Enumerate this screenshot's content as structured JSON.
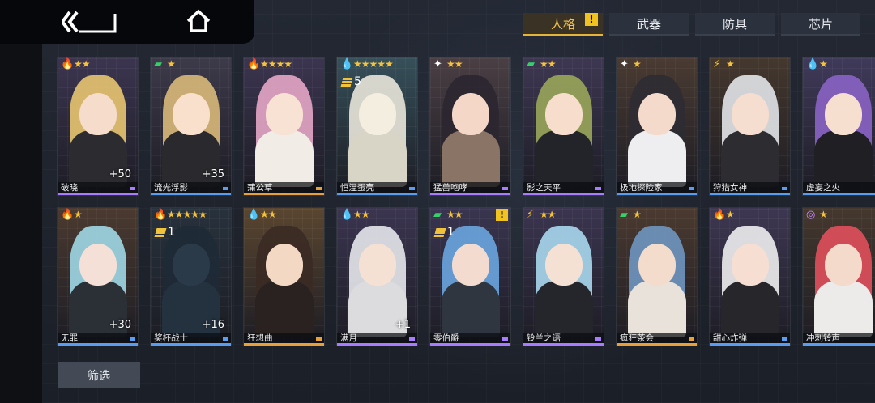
{
  "nav": {
    "back_icon": "back-chevron-icon",
    "home_icon": "home-icon"
  },
  "tabs": [
    {
      "label": "人格",
      "active": true,
      "alert": "!"
    },
    {
      "label": "武器",
      "active": false
    },
    {
      "label": "防具",
      "active": false
    },
    {
      "label": "芯片",
      "active": false
    }
  ],
  "filter": {
    "label": "筛选"
  },
  "elements": {
    "fire": {
      "glyph": "🔥",
      "color": "#ff5a3c"
    },
    "ice": {
      "glyph": "💧",
      "color": "#55b8ff"
    },
    "physical": {
      "glyph": "✦",
      "color": "#ffffff"
    },
    "wind": {
      "glyph": "▰",
      "color": "#35d06a"
    },
    "thunder": {
      "glyph": "⚡",
      "color": "#f5c025"
    },
    "psychic": {
      "glyph": "◎",
      "color": "#c88cff"
    }
  },
  "cards": [
    {
      "name": "破晓",
      "element": "fire",
      "stars": "★★",
      "bonus": "+50",
      "bg": "#3c3550",
      "hair": "#e8c570",
      "body": "#2b2b30",
      "skin": "#f5dccb",
      "rarity": "#a87cff"
    },
    {
      "name": "流光浮影",
      "element": "wind",
      "stars": "★",
      "bonus": "+35",
      "bg": "#3d3a4a",
      "hair": "#d9b97a",
      "body": "#2a2a2e",
      "skin": "#f8e0cc",
      "rarity": "#5a9cf0"
    },
    {
      "name": "蒲公草",
      "element": "fire",
      "stars": "★★★★",
      "bg": "#3b3550",
      "hair": "#e6a6c7",
      "body": "#f2ece6",
      "skin": "#f8e2d4",
      "rarity": "#e8a13a"
    },
    {
      "name": "恒温蛋壳",
      "element": "ice",
      "stars": "★★★★★",
      "stack": "5",
      "bg": "#36505a",
      "hair": "#e9e6da",
      "body": "#d8d4c6",
      "skin": "#f3eee0",
      "rarity": "#5a9cf0"
    },
    {
      "name": "猛兽咆哮",
      "element": "physical",
      "stars": "★★",
      "bg": "#4a3f44",
      "hair": "#2b2630",
      "body": "#8a7466",
      "skin": "#f4d7c6",
      "rarity": "#a87cff"
    },
    {
      "name": "影之天平",
      "element": "wind",
      "stars": "★★",
      "bg": "#3e3752",
      "hair": "#9aa65a",
      "body": "#23232a",
      "skin": "#f6ddcc",
      "rarity": "#a87cff"
    },
    {
      "name": "极地探险家",
      "element": "physical",
      "stars": "★",
      "bg": "#4a3b32",
      "hair": "#2d2b33",
      "body": "#eeeef0",
      "skin": "#f4dacb",
      "rarity": "#5a9cf0"
    },
    {
      "name": "狩猎女神",
      "element": "thunder",
      "stars": "★",
      "bg": "#45382e",
      "hair": "#e2e4e8",
      "body": "#2c2c31",
      "skin": "#f5ddcf",
      "rarity": "#5a9cf0"
    },
    {
      "name": "虚妄之火",
      "element": "ice",
      "stars": "★",
      "bg": "#403a5a",
      "hair": "#8a63c4",
      "body": "#1f1f24",
      "skin": "#f7dfd0",
      "rarity": "#5a9cf0"
    },
    {
      "name": "无罪",
      "element": "fire",
      "stars": "★",
      "bonus": "+30",
      "bg": "#4b3a30",
      "hair": "#9fd8e6",
      "body": "#2a3036",
      "skin": "#f4e0d6",
      "rarity": "#5a9cf0"
    },
    {
      "name": "奖杯战士",
      "element": "fire",
      "stars": "★★★★★",
      "stack": "1",
      "bonus": "+16",
      "bg": "#28323c",
      "hair": "#1e2a36",
      "body": "#243240",
      "skin": "#2a3a48",
      "rarity": "#5a9cf0"
    },
    {
      "name": "狂想曲",
      "element": "ice",
      "stars": "★★",
      "bg": "#5a4630",
      "hair": "#3a2a24",
      "body": "#2a2220",
      "skin": "#f3d8c4",
      "rarity": "#e8a13a"
    },
    {
      "name": "满月",
      "element": "ice",
      "stars": "★★",
      "bonus": "+1",
      "bg": "#3b3550",
      "hair": "#e6e8ec",
      "body": "#dcdcdf",
      "skin": "#f5e0d4",
      "rarity": "#a87cff"
    },
    {
      "name": "零伯爵",
      "element": "wind",
      "stars": "★★",
      "stack": "1",
      "alert": "!",
      "bg": "#3a3550",
      "hair": "#6aa6e0",
      "body": "#2f3640",
      "skin": "#f3dbcf",
      "rarity": "#a87cff"
    },
    {
      "name": "铃兰之语",
      "element": "thunder",
      "stars": "★★",
      "bg": "#3b3550",
      "hair": "#a9d8ee",
      "body": "#24262c",
      "skin": "#f5e0d4",
      "rarity": "#a87cff"
    },
    {
      "name": "疯狂茶会",
      "element": "wind",
      "stars": "★",
      "bg": "#4b3a30",
      "hair": "#6f96c0",
      "body": "#e9e2da",
      "skin": "#f4dccc",
      "rarity": "#e8a13a"
    },
    {
      "name": "甜心炸弹",
      "element": "fire",
      "stars": "★",
      "bg": "#3e3752",
      "hair": "#eeeef0",
      "body": "#26262b",
      "skin": "#f6dfd2",
      "rarity": "#5a9cf0"
    },
    {
      "name": "冲刺铃声",
      "element": "psychic",
      "stars": "★",
      "bg": "#45382e",
      "hair": "#e0505c",
      "body": "#ecebea",
      "skin": "#f4dacb",
      "rarity": "#5a9cf0"
    }
  ]
}
